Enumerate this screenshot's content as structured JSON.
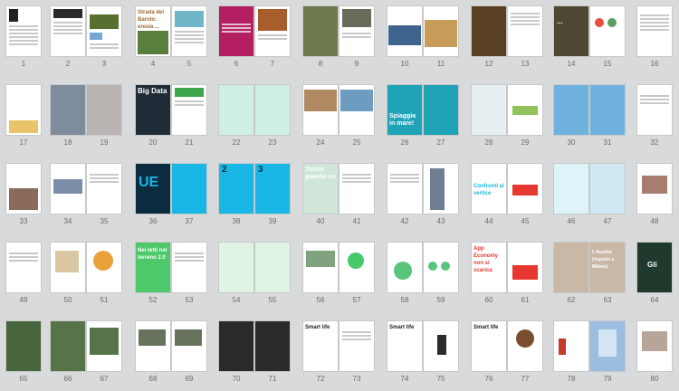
{
  "pages": [
    {
      "n": "1"
    },
    {
      "n": "2"
    },
    {
      "n": "3"
    },
    {
      "n": "4"
    },
    {
      "n": "5"
    },
    {
      "n": "6"
    },
    {
      "n": "7"
    },
    {
      "n": "8"
    },
    {
      "n": "9"
    },
    {
      "n": "10"
    },
    {
      "n": "11"
    },
    {
      "n": "12"
    },
    {
      "n": "13"
    },
    {
      "n": "14"
    },
    {
      "n": "15"
    },
    {
      "n": "16"
    },
    {
      "n": "17"
    },
    {
      "n": "18"
    },
    {
      "n": "19"
    },
    {
      "n": "20"
    },
    {
      "n": "21"
    },
    {
      "n": "22"
    },
    {
      "n": "23"
    },
    {
      "n": "24"
    },
    {
      "n": "25"
    },
    {
      "n": "26"
    },
    {
      "n": "27"
    },
    {
      "n": "28"
    },
    {
      "n": "29"
    },
    {
      "n": "30"
    },
    {
      "n": "31"
    },
    {
      "n": "32"
    },
    {
      "n": "33"
    },
    {
      "n": "34"
    },
    {
      "n": "35"
    },
    {
      "n": "36"
    },
    {
      "n": "37"
    },
    {
      "n": "38"
    },
    {
      "n": "39"
    },
    {
      "n": "40"
    },
    {
      "n": "41"
    },
    {
      "n": "42"
    },
    {
      "n": "43"
    },
    {
      "n": "44"
    },
    {
      "n": "45"
    },
    {
      "n": "46"
    },
    {
      "n": "47"
    },
    {
      "n": "48"
    },
    {
      "n": "49"
    },
    {
      "n": "50"
    },
    {
      "n": "51"
    },
    {
      "n": "52"
    },
    {
      "n": "53"
    },
    {
      "n": "54"
    },
    {
      "n": "55"
    },
    {
      "n": "56"
    },
    {
      "n": "57"
    },
    {
      "n": "58"
    },
    {
      "n": "59"
    },
    {
      "n": "60"
    },
    {
      "n": "61"
    },
    {
      "n": "62"
    },
    {
      "n": "63"
    },
    {
      "n": "64"
    },
    {
      "n": "65"
    },
    {
      "n": "66"
    },
    {
      "n": "67"
    },
    {
      "n": "68"
    },
    {
      "n": "69"
    },
    {
      "n": "70"
    },
    {
      "n": "71"
    },
    {
      "n": "72"
    },
    {
      "n": "73"
    },
    {
      "n": "74"
    },
    {
      "n": "75"
    },
    {
      "n": "76"
    },
    {
      "n": "77"
    },
    {
      "n": "78"
    },
    {
      "n": "79"
    },
    {
      "n": "80"
    }
  ],
  "titles": {
    "p4": "Strada del Barolo: eresia ...",
    "p14": "...",
    "p20": "Big Data",
    "p26": "Spiaggia in mare!",
    "p36": "UE",
    "p38a": "2",
    "p38b": "3",
    "p40": "Torino guarda su",
    "p44": "Confronti al vertice",
    "p52": "Nei tetti nel terreno 2.0",
    "p60": "App Economy non si scarica",
    "p62": "L'Austria (rispetto a Milano)",
    "p64": "Gli",
    "p72": "Smart life",
    "p74": "Smart life",
    "p76": "Smart life"
  },
  "colors": {
    "background": "#d9dadb",
    "page": "#ffffff",
    "cyan": "#19b7e6",
    "green": "#47c86a",
    "red": "#e6382e",
    "magenta": "#b41f62",
    "blue_photo": "#3d79b6",
    "dark_olive": "#4d4733",
    "light_blue": "#9bbde0"
  }
}
